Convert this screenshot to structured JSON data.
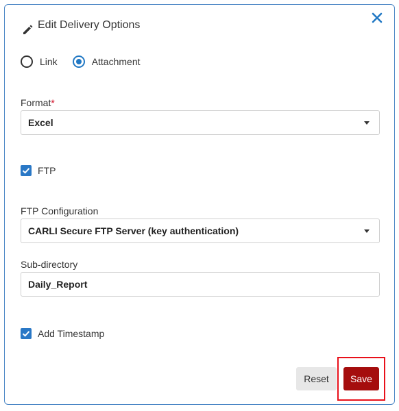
{
  "dialog": {
    "title": "Edit Delivery Options",
    "icons": {
      "title": "pencil-icon",
      "close": "close-icon"
    }
  },
  "delivery_mode": {
    "options": [
      "Link",
      "Attachment"
    ],
    "selected": "Attachment"
  },
  "format": {
    "label": "Format",
    "required_marker": "*",
    "value": "Excel"
  },
  "ftp": {
    "label": "FTP",
    "checked": true
  },
  "ftp_configuration": {
    "label": "FTP Configuration",
    "value": "CARLI Secure FTP Server (key authentication)"
  },
  "sub_directory": {
    "label": "Sub-directory",
    "value": "Daily_Report"
  },
  "timestamp": {
    "label": "Add Timestamp",
    "checked": true
  },
  "buttons": {
    "reset": "Reset",
    "save": "Save"
  },
  "colors": {
    "accent": "#2178c4",
    "save": "#a50d0d",
    "highlight": "#e8101a",
    "border": "#4a86c5"
  }
}
